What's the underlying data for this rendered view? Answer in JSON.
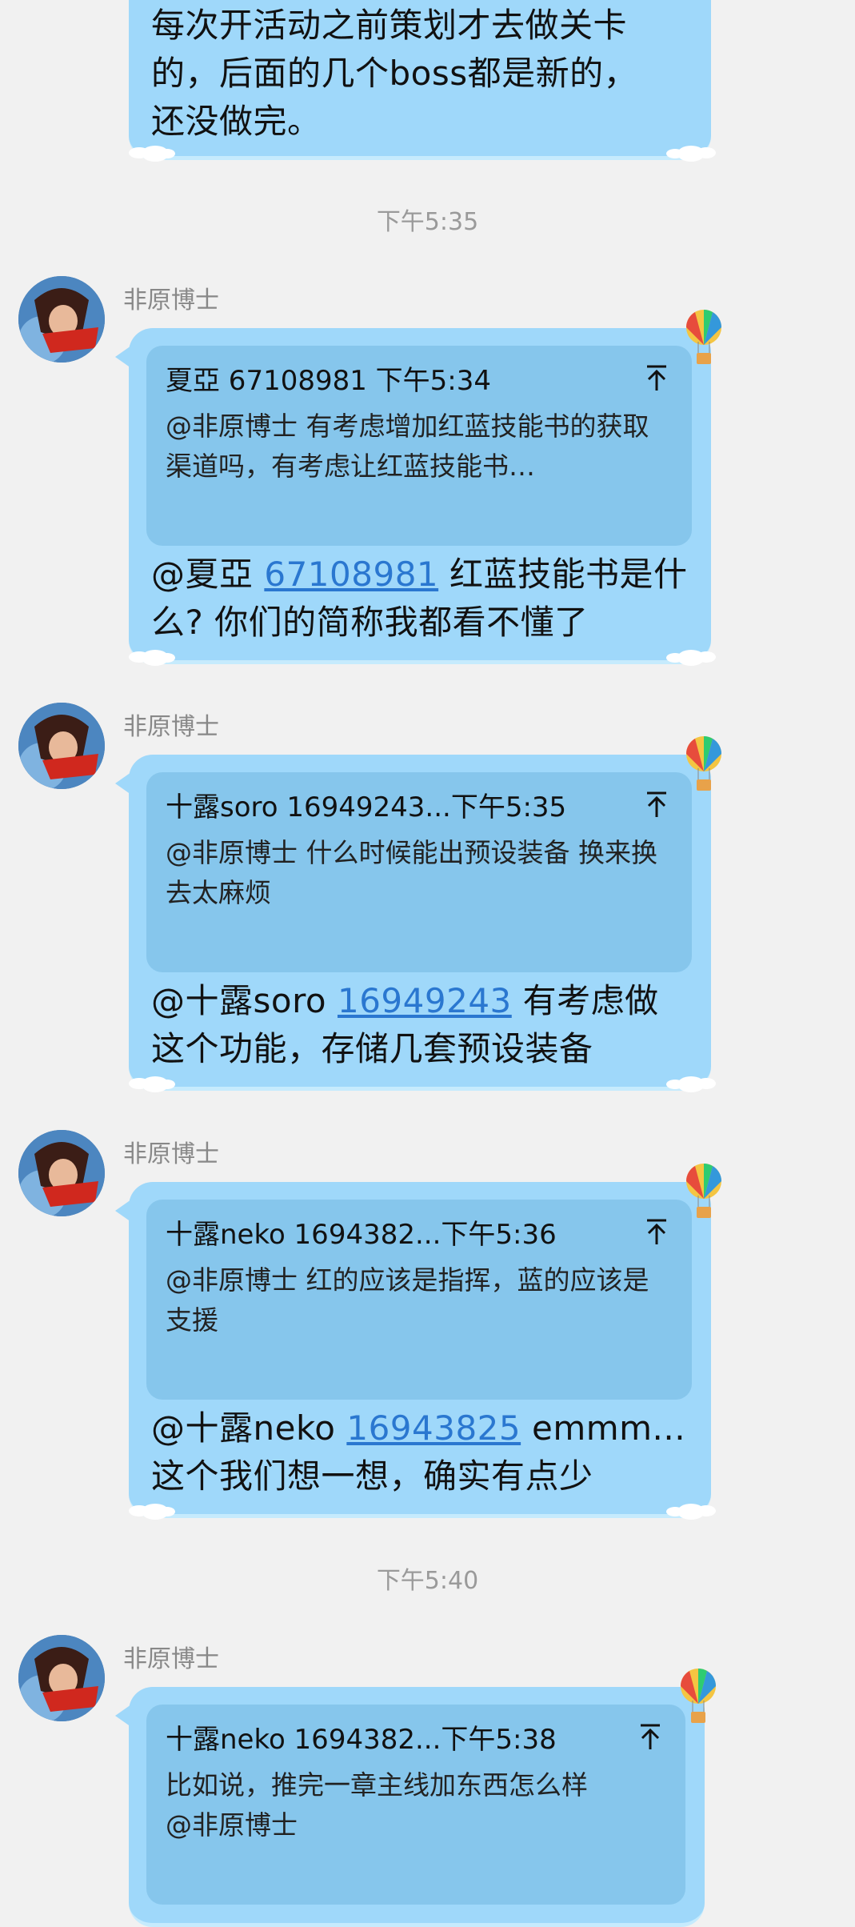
{
  "messages": [
    {
      "text": "每次开活动之前策划才去做关卡的，后面的几个boss都是新的，还没做完。"
    },
    {
      "sender": "非原博士",
      "quote": {
        "head": "夏亞 67108981 下午5:34",
        "body": "@非原博士 有考虑增加红蓝技能书的获取渠道吗，有考虑让红蓝技能书…"
      },
      "mention": "@夏亞 ",
      "link": "67108981",
      "text_line1": " 红蓝技能书是什",
      "text_line2": "么? 你们的简称我都看不懂了"
    },
    {
      "sender": "非原博士",
      "quote": {
        "head": "十露soro 16949243...下午5:35",
        "body": "@非原博士 什么时候能出预设装备 换来换去太麻烦"
      },
      "mention": "@十露soro ",
      "link": "16949243",
      "text_line1": " 有考虑做",
      "text_line2": "这个功能，存储几套预设装备"
    },
    {
      "sender": "非原博士",
      "quote": {
        "head": "十露neko 1694382...下午5:36",
        "body": "@非原博士 红的应该是指挥，蓝的应该是支援"
      },
      "mention": "@十露neko ",
      "link": "16943825",
      "text_line1": " emmm...",
      "text_line2": "这个我们想一想，确实有点少"
    },
    {
      "sender": "非原博士",
      "quote": {
        "head": "十露neko 1694382...下午5:38",
        "body": "比如说，推完一章主线加东西怎么样@非原博士"
      }
    }
  ],
  "timestamps": [
    "下午5:35",
    "下午5:40"
  ],
  "colors": {
    "bubble": "#9fd8fa",
    "quote": "#86c6ec",
    "link": "#2a77d0",
    "background": "#f1f1f1"
  },
  "icons": {
    "jump_to_quote": "arrow-up-to-line-icon",
    "bubble_decoration": "hot-air-balloon-icon"
  }
}
